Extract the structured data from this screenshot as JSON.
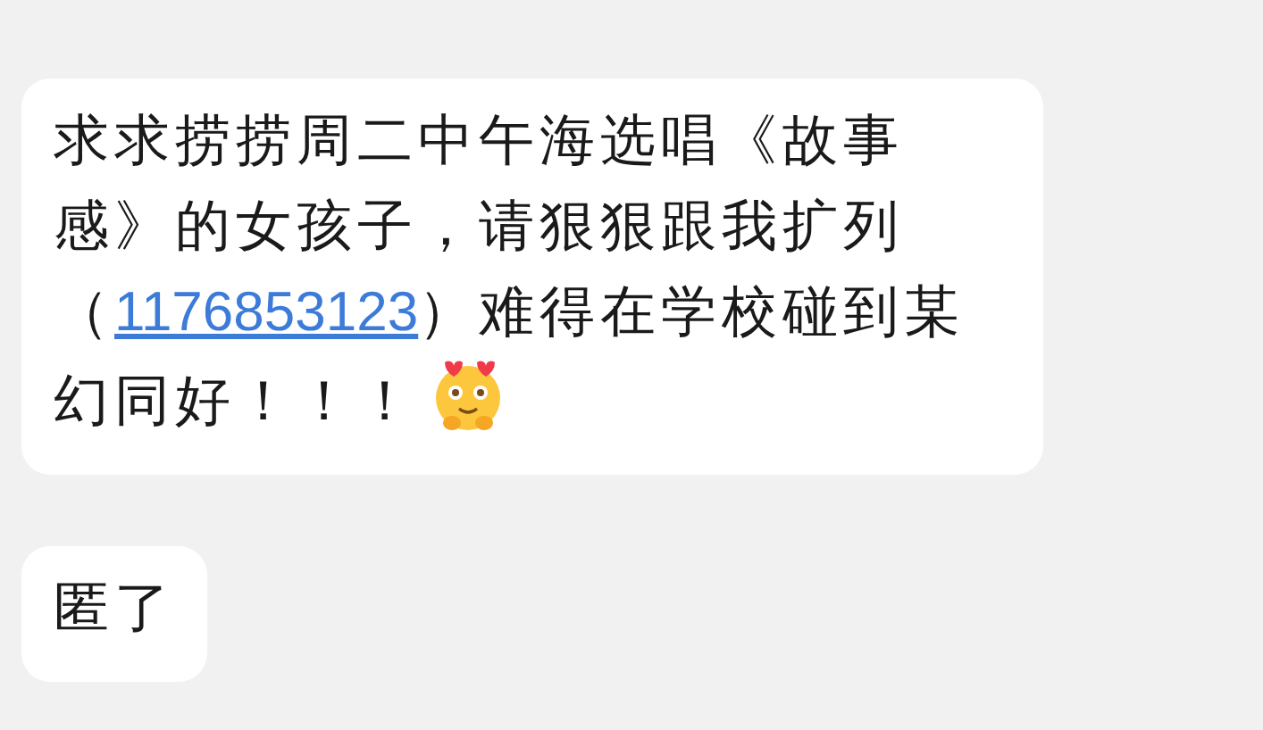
{
  "messages": [
    {
      "parts": [
        {
          "kind": "text",
          "text": "求求捞捞周二中午海选唱《故事感》的女孩子，请狠狠跟我扩列（"
        },
        {
          "kind": "link",
          "text": "1176853123"
        },
        {
          "kind": "text",
          "text": "）难得在学校碰到某幻同好！！！"
        },
        {
          "kind": "emoji"
        }
      ]
    },
    {
      "parts": [
        {
          "kind": "text",
          "text": "匿了"
        }
      ]
    }
  ]
}
